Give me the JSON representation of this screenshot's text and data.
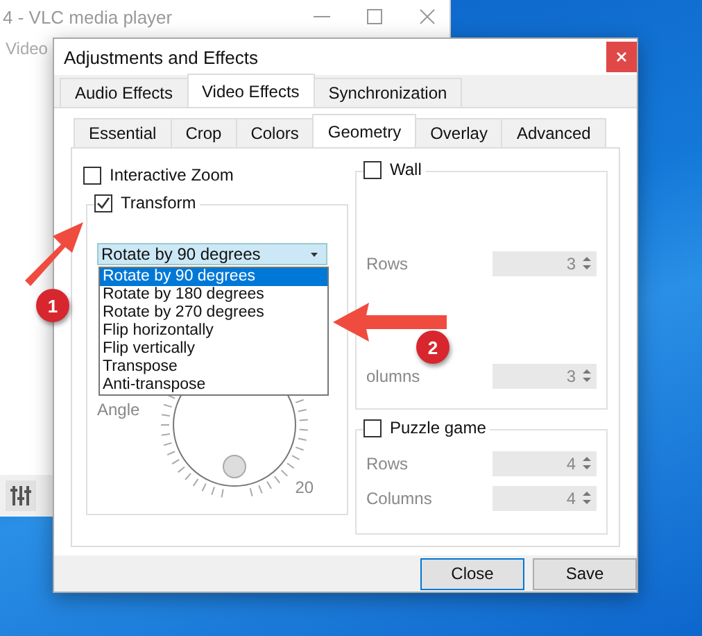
{
  "background_window": {
    "title": "4 - VLC media player",
    "menu": [
      "Video"
    ]
  },
  "dialog": {
    "title": "Adjustments and Effects",
    "tabs": [
      {
        "label": "Audio Effects",
        "selected": false
      },
      {
        "label": "Video Effects",
        "selected": true
      },
      {
        "label": "Synchronization",
        "selected": false
      }
    ],
    "subtabs": [
      {
        "label": "Essential",
        "selected": false
      },
      {
        "label": "Crop",
        "selected": false
      },
      {
        "label": "Colors",
        "selected": false
      },
      {
        "label": "Geometry",
        "selected": true
      },
      {
        "label": "Overlay",
        "selected": false
      },
      {
        "label": "Advanced",
        "selected": false
      }
    ],
    "interactive_zoom": {
      "label": "Interactive Zoom",
      "checked": false
    },
    "transform": {
      "label": "Transform",
      "checked": true,
      "value": "Rotate by 90 degrees",
      "options": [
        {
          "label": "Rotate by 90 degrees",
          "selected": true
        },
        {
          "label": "Rotate by 180 degrees",
          "selected": false
        },
        {
          "label": "Rotate by 270 degrees",
          "selected": false
        },
        {
          "label": "Flip horizontally",
          "selected": false
        },
        {
          "label": "Flip vertically",
          "selected": false
        },
        {
          "label": "Transpose",
          "selected": false
        },
        {
          "label": "Anti-transpose",
          "selected": false
        }
      ],
      "angle_label": "Angle",
      "angle_reading": "20"
    },
    "wall": {
      "label": "Wall",
      "checked": false,
      "fields": [
        {
          "label": "Rows",
          "value": "3",
          "disabled": true
        },
        {
          "label": "olumns",
          "value": "3",
          "disabled": true
        }
      ]
    },
    "puzzle": {
      "label": "Puzzle game",
      "checked": false,
      "fields": [
        {
          "label": "Rows",
          "value": "4",
          "disabled": true
        },
        {
          "label": "Columns",
          "value": "4",
          "disabled": true
        }
      ]
    },
    "buttons": [
      {
        "label": "Close",
        "kind": "default"
      },
      {
        "label": "Save",
        "kind": "normal"
      }
    ]
  },
  "annotations": [
    {
      "number": "1"
    },
    {
      "number": "2"
    }
  ]
}
